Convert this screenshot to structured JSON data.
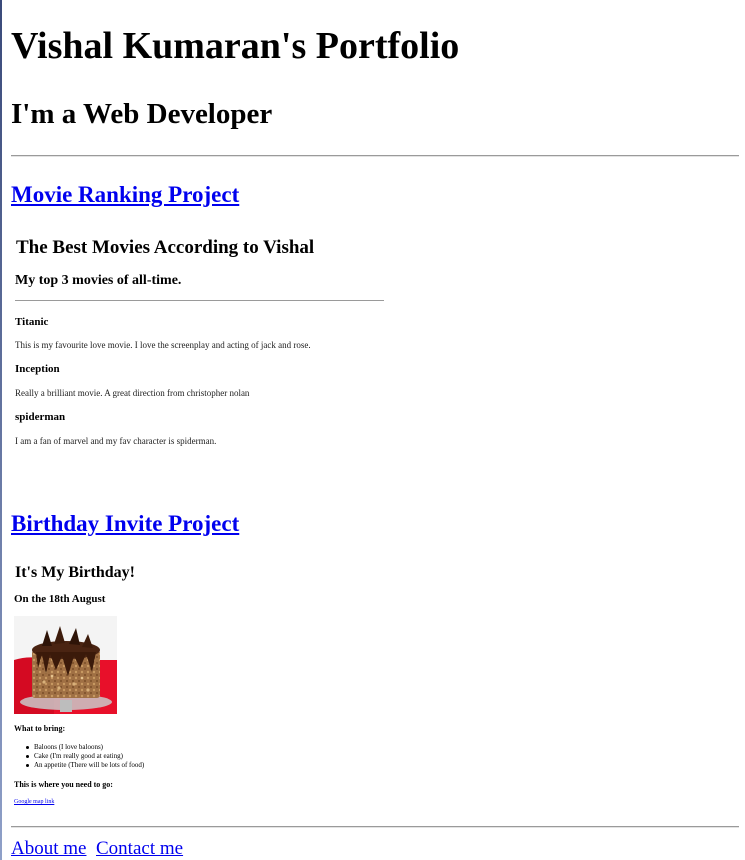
{
  "portfolio": {
    "title": "Vishal Kumaran's Portfolio",
    "subtitle": "I'm a Web Developer"
  },
  "movie_project": {
    "link_label": "Movie Ranking Project",
    "page_title": "The Best Movies According to Vishal",
    "page_subtitle": "My top 3 movies of all-time.",
    "movies": [
      {
        "name": "Titanic",
        "description": "This is my favourite love movie. I love the screenplay and acting of jack and rose."
      },
      {
        "name": "Inception",
        "description": "Really a brilliant movie. A great direction from christopher nolan"
      },
      {
        "name": "spiderman",
        "description": "I am a fan of marvel and my fav character is spiderman."
      }
    ]
  },
  "birthday_project": {
    "link_label": "Birthday Invite Project",
    "page_title": "It's My Birthday!",
    "date": "On the 18th August",
    "bring_heading": "What to bring:",
    "bring_items": [
      "Baloons (I love baloons)",
      "Cake (I'm really good at eating)",
      "An appetite (There will be lots of food)"
    ],
    "where_heading": "This is where you need to go:",
    "map_link": "Google map link"
  },
  "footer": {
    "about_label": "About me",
    "contact_label": "Contact me"
  },
  "colors": {
    "link": "#0000ee",
    "cake_background": "#e8102a"
  }
}
